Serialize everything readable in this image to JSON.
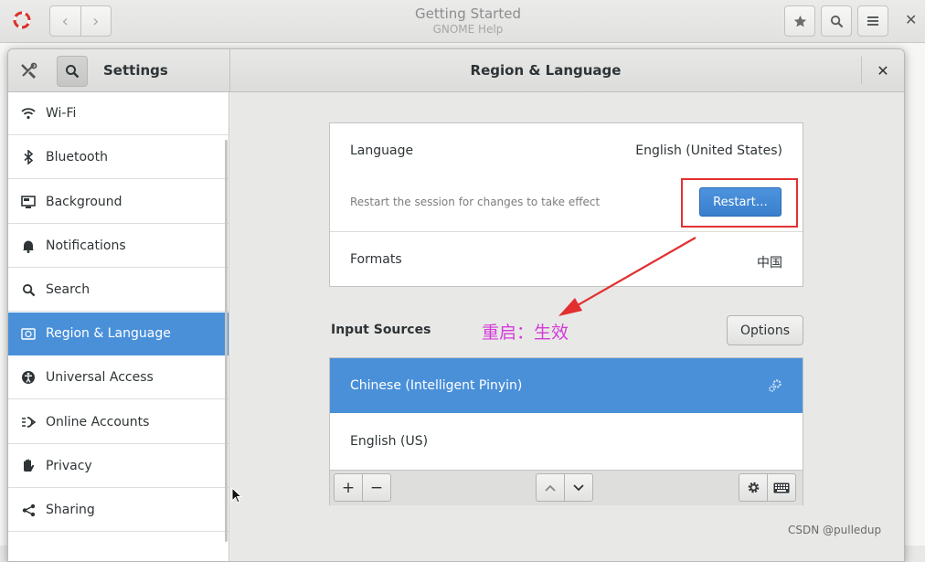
{
  "help_window": {
    "title": "Getting Started",
    "subtitle": "GNOME Help",
    "close_glyph": "✕"
  },
  "settings_window": {
    "app_title": "Settings",
    "page_title": "Region & Language",
    "close_glyph": "✕"
  },
  "sidebar": {
    "items": [
      {
        "label": "Wi-Fi",
        "icon": "wifi-icon"
      },
      {
        "label": "Bluetooth",
        "icon": "bluetooth-icon"
      },
      {
        "label": "Background",
        "icon": "background-icon"
      },
      {
        "label": "Notifications",
        "icon": "bell-icon"
      },
      {
        "label": "Search",
        "icon": "search-icon"
      },
      {
        "label": "Region & Language",
        "icon": "region-icon",
        "selected": true
      },
      {
        "label": "Universal Access",
        "icon": "accessibility-icon"
      },
      {
        "label": "Online Accounts",
        "icon": "online-accounts-icon"
      },
      {
        "label": "Privacy",
        "icon": "hand-icon"
      },
      {
        "label": "Sharing",
        "icon": "share-icon"
      }
    ]
  },
  "language": {
    "label": "Language",
    "value": "English (United States)",
    "notice": "Restart the session for changes to take effect",
    "restart_label": "Restart…"
  },
  "formats": {
    "label": "Formats",
    "value": "中国"
  },
  "input_sources": {
    "title": "Input Sources",
    "options_label": "Options",
    "sources": [
      {
        "label": "Chinese (Intelligent Pinyin)",
        "selected": true
      },
      {
        "label": "English (US)",
        "selected": false
      }
    ],
    "toolbar": {
      "add": "+",
      "remove": "−"
    }
  },
  "annotation": {
    "text": "重启：生效",
    "color": "#d43ad9"
  },
  "colors": {
    "accent": "#4a90d9",
    "highlight_box": "#e23030"
  },
  "watermark": "CSDN @pulledup"
}
